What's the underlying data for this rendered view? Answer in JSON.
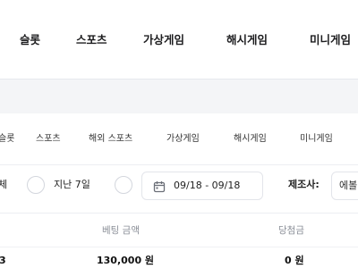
{
  "top_nav": {
    "items": [
      {
        "label": "슬롯"
      },
      {
        "label": "스포츠"
      },
      {
        "label": "가상게임"
      },
      {
        "label": "해시게임"
      },
      {
        "label": "미니게임"
      }
    ]
  },
  "sub_nav": {
    "items": [
      {
        "label": "슬롯"
      },
      {
        "label": "스포츠"
      },
      {
        "label": "해외 스포츠"
      },
      {
        "label": "가상게임"
      },
      {
        "label": "해시게임"
      },
      {
        "label": "미니게임"
      }
    ]
  },
  "filters": {
    "all_partial": "체",
    "last7_label": "지난 7일",
    "date_range": "09/18 - 09/18",
    "maker_label": "제조사:",
    "maker_value": "에볼"
  },
  "table": {
    "headers": {
      "bet_amount": "베팅 금액",
      "win_amount": "당첨금"
    },
    "rows": [
      {
        "id_partial": "3",
        "bet_amount": "130,000 원",
        "win_amount": "0 원"
      }
    ]
  },
  "icons": {
    "calendar": "calendar-icon"
  },
  "colors": {
    "band_gray": "#f4f5f7",
    "header_text": "#8b8f98",
    "border": "#e3e5ea"
  }
}
